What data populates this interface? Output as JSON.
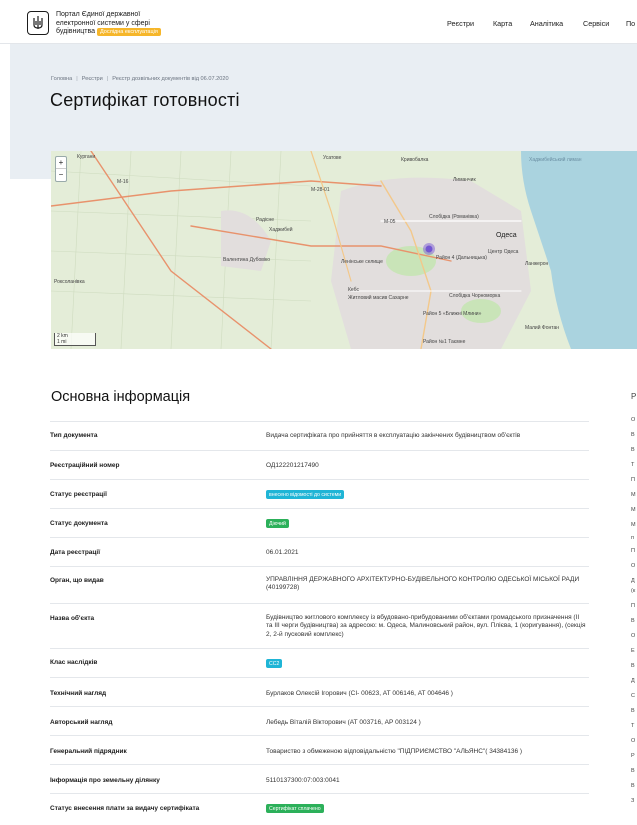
{
  "header": {
    "brand_line1": "Портал Єдиної державної",
    "brand_line2": "електронної системи у сфері",
    "brand_line3": "будівництва",
    "beta_label": "Дослідна експлуатація",
    "nav": [
      "Реєстри",
      "Карта",
      "Аналітика",
      "Сервіси",
      "По"
    ]
  },
  "breadcrumbs": [
    "Головна",
    "Реєстри",
    "Реєстр дозвільних документів від 06.07.2020"
  ],
  "page_title": "Сертифікат готовності",
  "map": {
    "zoom_in": "+",
    "zoom_out": "−",
    "scale_km": "2 km",
    "scale_mi": "1 mi",
    "labels": [
      "Кургани",
      "М-16",
      "М-28-01",
      "Усатове",
      "Лиманчик",
      "Кривобалка",
      "Хаджибей",
      "Радісне",
      "М-05",
      "Слобідка (Романівка)",
      "Одеса",
      "Район 4 (Дальницька)",
      "Валентина Дубовіко",
      "Ленінське селище",
      "Кебс",
      "Житловий масив Сахарне",
      "Роксоланівка",
      "Центр Одеса",
      "Ланжерон",
      "Слобідка Чорноморка",
      "Район 5 «Ближні Млини»",
      "Район №1 Таємне",
      "Малий Фонтан",
      "Хаджибейський лиман"
    ]
  },
  "section_title": "Основна інформація",
  "info_rows": [
    {
      "key": "Тип документа",
      "value": "Видача сертифіката про прийняття в експлуатацію закінчених будівництвом об'єктів"
    },
    {
      "key": "Реєстраційний номер",
      "value": "ОД122201217490"
    },
    {
      "key": "Статус реєстрації",
      "badge": "внесено відомості до системи",
      "badge_color": "#1fb5d6"
    },
    {
      "key": "Статус документа",
      "badge": "Діючий",
      "badge_color": "#2cb05a"
    },
    {
      "key": "Дата реєстрації",
      "value": "06.01.2021"
    },
    {
      "key": "Орган, що видав",
      "value": "УПРАВЛІННЯ ДЕРЖАВНОГО АРХІТЕКТУРНО-БУДІВЕЛЬНОГО КОНТРОЛЮ ОДЕСЬКОЇ МІСЬКОЇ РАДИ (40199728)"
    },
    {
      "key": "Назва об'єкта",
      "value": "Будівництво житлового комплексу із вбудовано-прибудованими об'єктами громадського призначення (ІІ та ІІІ черги будівництва) за адресою: м. Одеса, Малиновський район, вул. Плієва, 1 (коригування), (секція 2, 2-й пусковий комплекс)"
    },
    {
      "key": "Клас наслідків",
      "badge": "СС2",
      "badge_color": "#1fb5d6"
    },
    {
      "key": "Технічний нагляд",
      "value": "Бурлаков Олексій Ігорович (СІ- 00623, АТ 006146, АТ 004646 )"
    },
    {
      "key": "Авторський нагляд",
      "value": "Лебедь Віталій Вікторович (АТ 003716, АР 003124 )"
    },
    {
      "key": "Генеральний підрядник",
      "value": "Товариство з обмеженою відповідальністю \"ПІДПРИЄМСТВО \"АЛЬЯНС\"( 34384136 )"
    },
    {
      "key": "Інформація про земельну ділянку",
      "value": "5110137300:07:003:0041"
    },
    {
      "key": "Статус внесення плати за видачу сертифіката",
      "badge": "Сертифікат сплачено",
      "badge_color": "#2cb05a"
    }
  ],
  "side_letters": [
    "Р",
    "О",
    "В",
    "В",
    "Т",
    "П",
    "М",
    "М",
    "М",
    "п",
    "П",
    "О",
    "Д",
    "(к",
    "П",
    "В",
    "О",
    "Е",
    "В",
    "Д",
    "С",
    "В",
    "Т",
    "О",
    "Р",
    "В",
    "В",
    "З"
  ]
}
